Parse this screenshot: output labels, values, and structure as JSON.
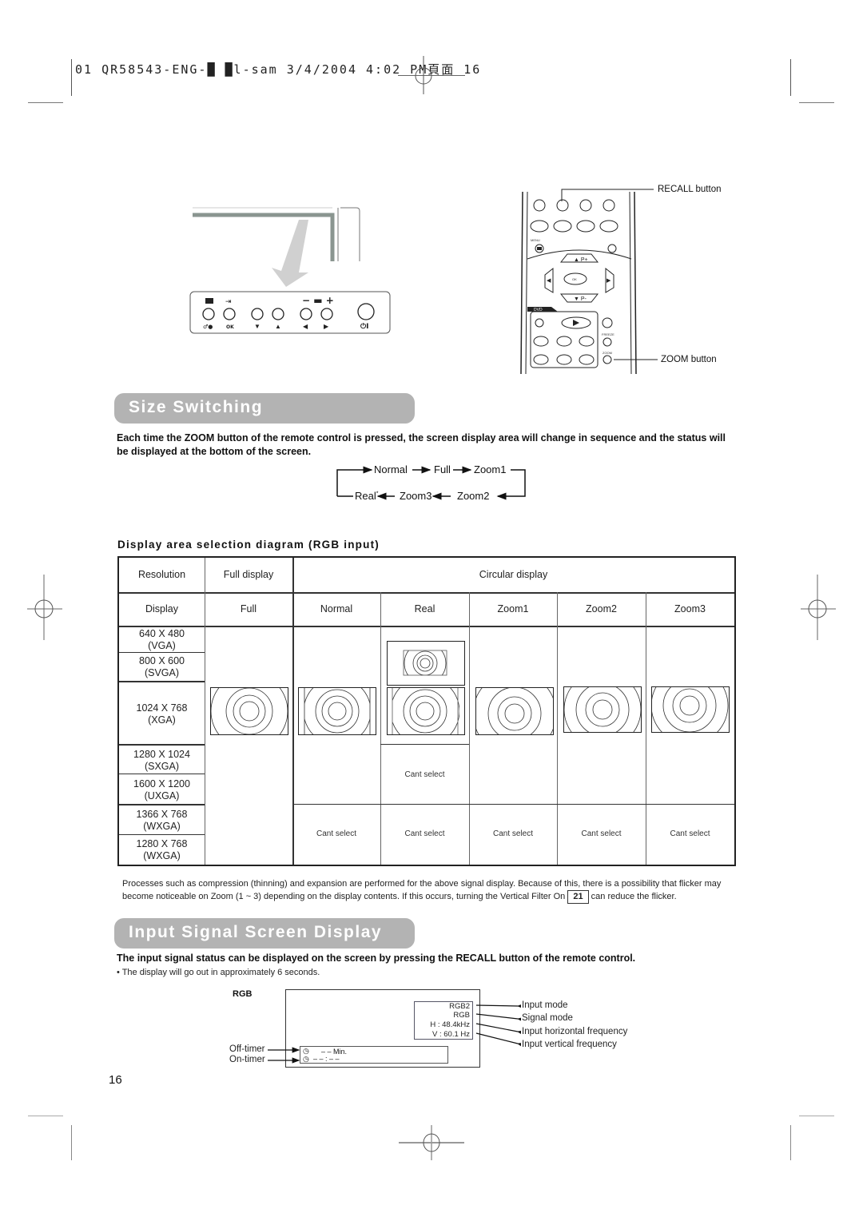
{
  "print_header": "01 QR58543-ENG-█  █l-sam  3/4/2004  4:02 PM頁面 16",
  "remote": {
    "recall_label": "RECALL button",
    "zoom_label": "ZOOM button",
    "menu_label": "MENU",
    "dvd_label": "DVD",
    "freeze_label": "FREEZE",
    "zoom_small": "ZOOM",
    "p_plus": "P+",
    "p_minus": "P-",
    "ok": "OK"
  },
  "panel": {
    "buttons": [
      "menu/sound",
      "input/ok",
      "down",
      "up",
      "vol-minus/left",
      "vol-plus/right",
      "power"
    ]
  },
  "size_switching": {
    "title": "Size Switching",
    "intro": "Each time the ZOOM button of the remote control is pressed, the screen display area will change in sequence and the status will be displayed at the bottom of the screen.",
    "sequence_top": [
      "Normal",
      "Full",
      "Zoom1"
    ],
    "sequence_bottom": [
      "Real",
      "Zoom3",
      "Zoom2"
    ],
    "real_mark": "*"
  },
  "table": {
    "title": "Display area selection diagram (RGB input)",
    "header1": {
      "resolution": "Resolution",
      "full_display": "Full display",
      "circular_display": "Circular display"
    },
    "header2": [
      "Display",
      "Full",
      "Normal",
      "Real",
      "Zoom1",
      "Zoom2",
      "Zoom3"
    ],
    "resolutions": [
      {
        "res": "640 X 480",
        "name": "(VGA)"
      },
      {
        "res": "800 X 600",
        "name": "(SVGA)"
      },
      {
        "res": "1024 X 768",
        "name": "(XGA)"
      },
      {
        "res": "1280 X 1024",
        "name": "(SXGA)"
      },
      {
        "res": "1600 X 1200",
        "name": "(UXGA)"
      },
      {
        "res": "1366 X 768",
        "name": "(WXGA)"
      },
      {
        "res": "1280 X 768",
        "name": "(WXGA)"
      }
    ],
    "cant_select": "Cant select"
  },
  "footnote": {
    "text_before": "Processes such as compression (thinning) and expansion are performed for the above signal display. Because of this, there is a possibility that flicker may become noticeable on Zoom (1 ~ 3) depending on the display contents. If this occurs, turning the Vertical Filter On",
    "page_ref": "21",
    "text_after": "can reduce the flicker."
  },
  "input_signal": {
    "title": "Input Signal Screen Display",
    "intro": "The input signal status can be displayed on the screen by pressing the RECALL button of the remote control.",
    "bullet": "•  The display will go out in approximately 6 seconds.",
    "osd_title": "RGB",
    "osd_lines": [
      "RGB2",
      "RGB",
      "H :   48.4kHz",
      "V :   60.1  Hz"
    ],
    "off_timer_value": "– – Min.",
    "on_timer_value": "– – : – –",
    "off_timer_label": "Off-timer",
    "on_timer_label": "On-timer",
    "annotations": [
      "Input mode",
      "Signal mode",
      "Input horizontal frequency",
      "Input vertical frequency"
    ]
  },
  "page_number": "16"
}
